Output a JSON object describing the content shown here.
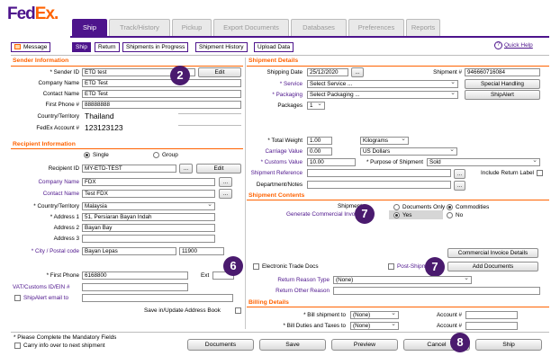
{
  "brand": {
    "fed": "Fed",
    "ex": "Ex",
    "dot": "."
  },
  "tabs": [
    "Ship",
    "Track/History",
    "Pickup",
    "Export Documents",
    "Databases",
    "Preferences",
    "Reports"
  ],
  "toolbar": {
    "message": "Message",
    "buttons": [
      "Ship",
      "Return",
      "Shipments in Progress",
      "Shipment History",
      "Upload Data"
    ],
    "help": "Quick Help"
  },
  "sender": {
    "title": "Sender Information",
    "sender_id_label": "* Sender ID",
    "sender_id": "ETD test",
    "edit": "Edit",
    "company_label": "Company Name",
    "company": "ETD Test",
    "contact_label": "Contact Name",
    "contact": "ETD Test",
    "phone_label": "First Phone #",
    "phone": "88888888",
    "country_label": "Country/Territory",
    "country": "Thailand",
    "account_label": "FedEx Account #",
    "account": "123123123"
  },
  "recipient": {
    "title": "Recipient Information",
    "single": "Single",
    "group": "Group",
    "id_label": "Recipient ID",
    "id": "MY-ETD-TEST",
    "dots": "...",
    "edit": "Edit",
    "company_label": "Company Name",
    "company": "FDX",
    "contact_label": "Contact Name",
    "contact": "Test FDX",
    "country_label": "* Country/Territory",
    "country": "Malaysia",
    "addr1_label": "* Address 1",
    "addr1": "51, Persiaran Bayan Indah",
    "addr2_label": "Address 2",
    "addr2": "Bayan Bay",
    "addr3_label": "Address 3",
    "addr3": "",
    "city_label": "* City / Postal code",
    "city": "Bayan Lepas",
    "postal": "11900",
    "phone_label": "* First Phone",
    "phone": "6168800",
    "ext_label": "Ext",
    "vat_label": "VAT/Customs ID/EIN #",
    "shipalert_label": "ShipAlert email to",
    "save_label": "Save in/Update Address Book"
  },
  "shipment": {
    "title": "Shipment Details",
    "date_label": "Shipping Date",
    "date": "25/12/2020",
    "num_label": "Shipment #",
    "num": "946660716084",
    "service_label": "* Service",
    "service": "Select Service ...",
    "special": "Special Handling",
    "packaging_label": "* Packaging",
    "packaging": "Select Packaging ...",
    "shipalert": "ShipAlert",
    "packages_label": "Packages",
    "packages": "1",
    "weight_label": "* Total Weight",
    "weight": "1.00",
    "weight_unit": "Kilograms",
    "carriage_label": "Carriage Value",
    "carriage": "0.00",
    "currency": "US Dollars",
    "customs_label": "* Customs Value",
    "customs": "10.00",
    "purpose_label": "* Purpose of Shipment",
    "purpose": "Sold",
    "include_return": "Include Return Label",
    "reference_label": "Shipment Reference",
    "dept_label": "Department/Notes"
  },
  "contents": {
    "title": "Shipment Contents",
    "shipment_label": "Shipment",
    "generate_label": "Generate Commercial Invoice",
    "docs_only": "Documents Only",
    "commodities": "Commodities",
    "yes": "Yes",
    "no": "No",
    "ci_details": "Commercial Invoice Details",
    "etd": "Electronic Trade Docs",
    "post_ship": "Post-Shipm",
    "add_docs": "Add Documents",
    "return_type_label": "Return Reason Type",
    "return_type": "(None)",
    "return_other_label": "Return Other Reason"
  },
  "billing": {
    "title": "Billing Details",
    "bill_to_label": "* Bill shipment to",
    "bill_to": "(None)",
    "duties_label": "* Bill Duties and Taxes to",
    "duties": "(None)",
    "account_label": "Account #"
  },
  "footer": {
    "mandatory": "* Please Complete the Mandatory Fields",
    "carry": "Carry info over to next shipment",
    "buttons": [
      "Documents",
      "Save",
      "Preview",
      "Cancel",
      "Ship"
    ]
  },
  "badges": [
    "2",
    "6",
    "7",
    "7",
    "8"
  ]
}
